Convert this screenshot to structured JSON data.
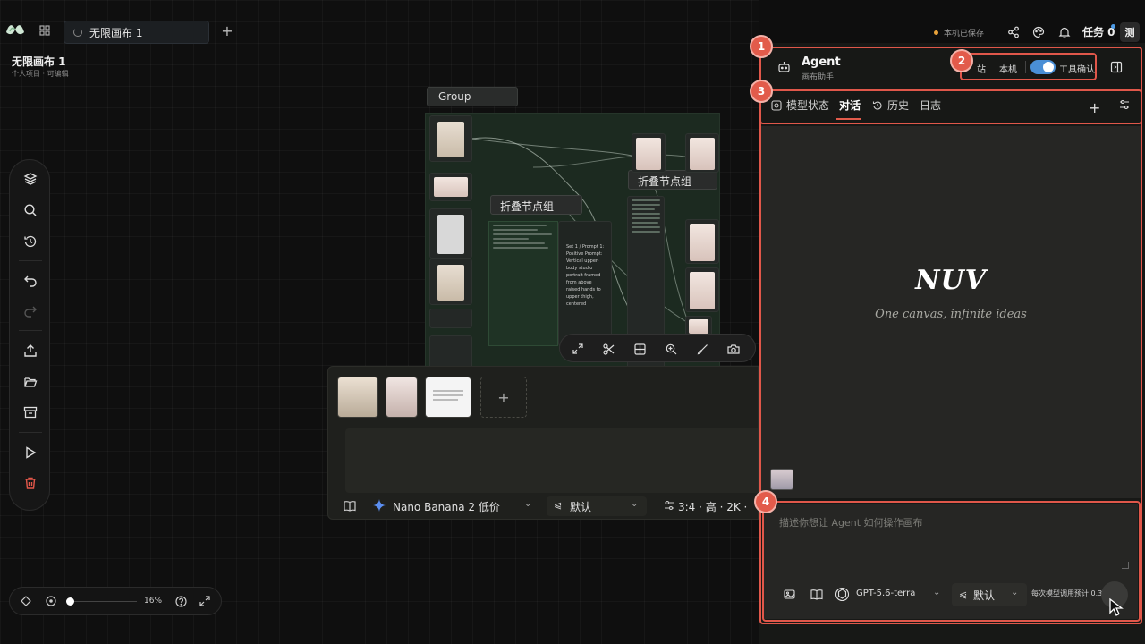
{
  "app": {
    "tab_title": "无限画布 1",
    "project_title": "无限画布 1",
    "project_subtitle": "个人项目 · 可编辑",
    "save_status": "本机已保存",
    "tasks_label": "任务 0",
    "user_initial": "测"
  },
  "canvas": {
    "group_label": "Group",
    "fold_group_1": "折叠节点组",
    "fold_group_2": "折叠节点组",
    "node_text": "Set 1 / Prompt 1: Positive Prompt: Vertical upper-body studio portrait framed from above raised hands to upper thigh, centered",
    "zoom_percent": "16%"
  },
  "prompt_panel": {
    "model_name": "Nano Banana 2 低价",
    "style_value": "默认",
    "params": "3:4 · 高 · 2K ·"
  },
  "agent": {
    "title": "Agent",
    "subtitle": "画布助手",
    "mode_cloud": "站",
    "mode_local": "本机",
    "tool_confirm": "工具确认",
    "tabs": [
      "模型状态",
      "对话",
      "历史",
      "日志"
    ],
    "brand": "NUV",
    "tagline": "One canvas, infinite ideas",
    "input_placeholder": "描述你想让 Agent 如何操作画布",
    "model": "GPT-5.6-terra",
    "style": "默认",
    "cost_note": "每次模型调用预计 0.36 积分",
    "badges": [
      "1",
      "2",
      "3",
      "4"
    ]
  },
  "colors": {
    "accent_red": "#e25b4b",
    "toggle_blue": "#4a8fd6"
  }
}
